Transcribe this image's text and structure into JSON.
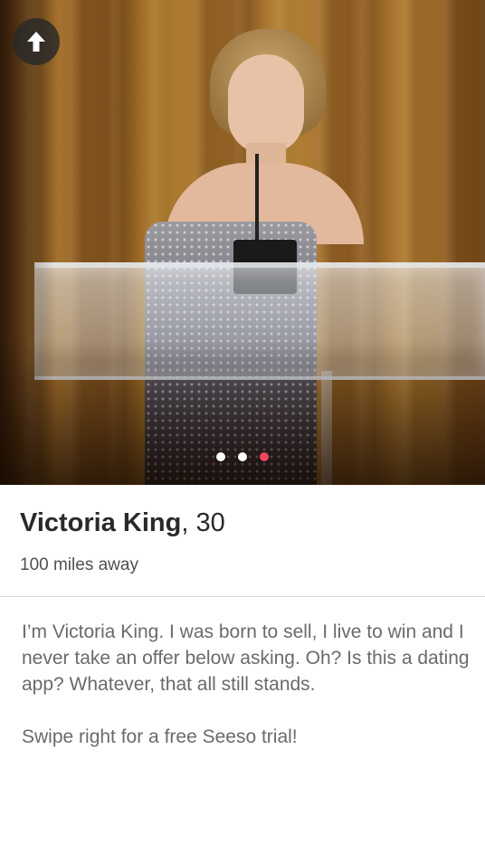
{
  "photo": {
    "description_icon": "profile-photo",
    "dots": [
      {
        "active": false
      },
      {
        "active": false
      },
      {
        "active": true
      }
    ],
    "active_dot_color": "#f0465c"
  },
  "back_button": {
    "icon": "arrow-up-icon"
  },
  "profile": {
    "name": "Victoria King",
    "separator": ",",
    "age": "30",
    "distance": "100 miles away"
  },
  "bio": {
    "paragraph_1": "I’m Victoria King. I was born to sell, I live to win and I never take an offer below asking. Oh? Is this a dating app? Whatever, that all still stands.",
    "paragraph_2": "Swipe right for a free Seeso trial!"
  }
}
